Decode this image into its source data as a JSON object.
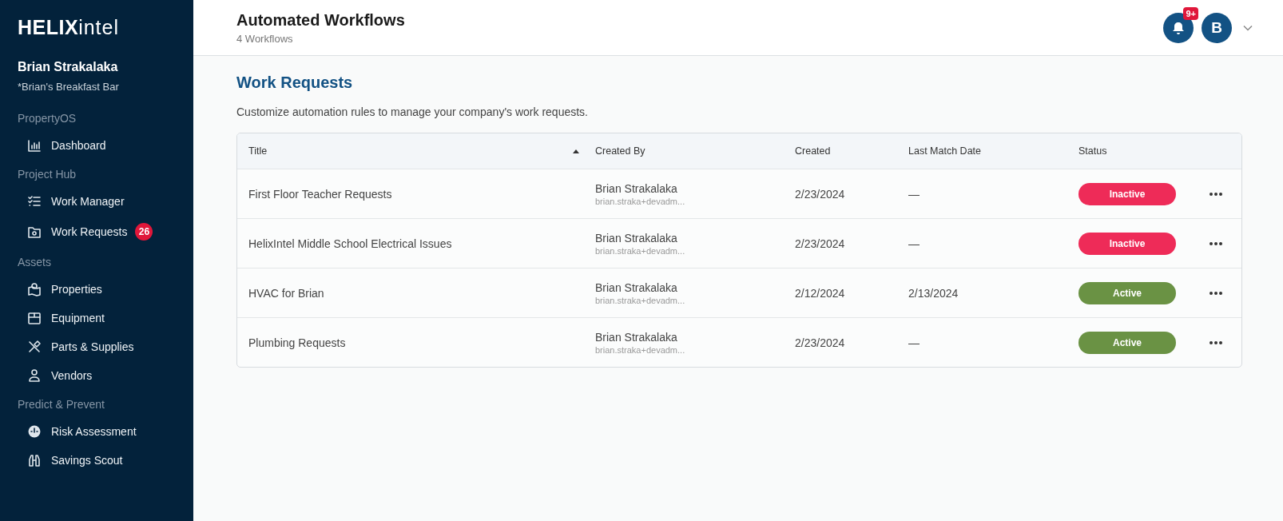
{
  "sidebar": {
    "logo": "**HELIX**intel",
    "user_name": "Brian Strakalaka",
    "org_name": "*Brian's Breakfast Bar",
    "sections": [
      {
        "heading": "PropertyOS",
        "items": [
          {
            "label": "Dashboard"
          }
        ]
      },
      {
        "heading": "Project Hub",
        "items": [
          {
            "label": "Work Manager"
          },
          {
            "label": "Work Requests",
            "badge": "26"
          }
        ]
      },
      {
        "heading": "Assets",
        "items": [
          {
            "label": "Properties"
          },
          {
            "label": "Equipment"
          },
          {
            "label": "Parts & Supplies"
          },
          {
            "label": "Vendors"
          }
        ]
      },
      {
        "heading": "Predict & Prevent",
        "items": [
          {
            "label": "Risk Assessment"
          },
          {
            "label": "Savings Scout"
          }
        ]
      }
    ]
  },
  "header": {
    "title": "Automated Workflows",
    "subtitle": "4 Workflows",
    "notification_badge": "9+",
    "avatar_initial": "B"
  },
  "section": {
    "title": "Work Requests",
    "description": "Customize automation rules to manage your company's work requests."
  },
  "table": {
    "columns": [
      {
        "label": "Title",
        "sorted": true
      },
      {
        "label": "Created By",
        "sorted": false
      },
      {
        "label": "Created",
        "sorted": false
      },
      {
        "label": "Last Match Date",
        "sorted": false
      },
      {
        "label": "Status",
        "sorted": false
      }
    ],
    "rows": [
      {
        "title": "First Floor Teacher Requests",
        "created_by": "Brian Strakalaka",
        "email": "brian.straka+devadm...",
        "created": "2/23/2024",
        "last_match_date": "—",
        "status": "Inactive",
        "active": false
      },
      {
        "title": "HelixIntel Middle School Electrical Issues",
        "created_by": "Brian Strakalaka",
        "email": "brian.straka+devadm...",
        "created": "2/23/2024",
        "last_match_date": "—",
        "status": "Inactive",
        "active": false
      },
      {
        "title": "HVAC for Brian",
        "created_by": "Brian Strakalaka",
        "email": "brian.straka+devadm...",
        "created": "2/12/2024",
        "last_match_date": "2/13/2024",
        "status": "Active",
        "active": true
      },
      {
        "title": "Plumbing Requests",
        "created_by": "Brian Strakalaka",
        "email": "brian.straka+devadm...",
        "created": "2/23/2024",
        "last_match_date": "—",
        "status": "Active",
        "active": true
      }
    ]
  }
}
